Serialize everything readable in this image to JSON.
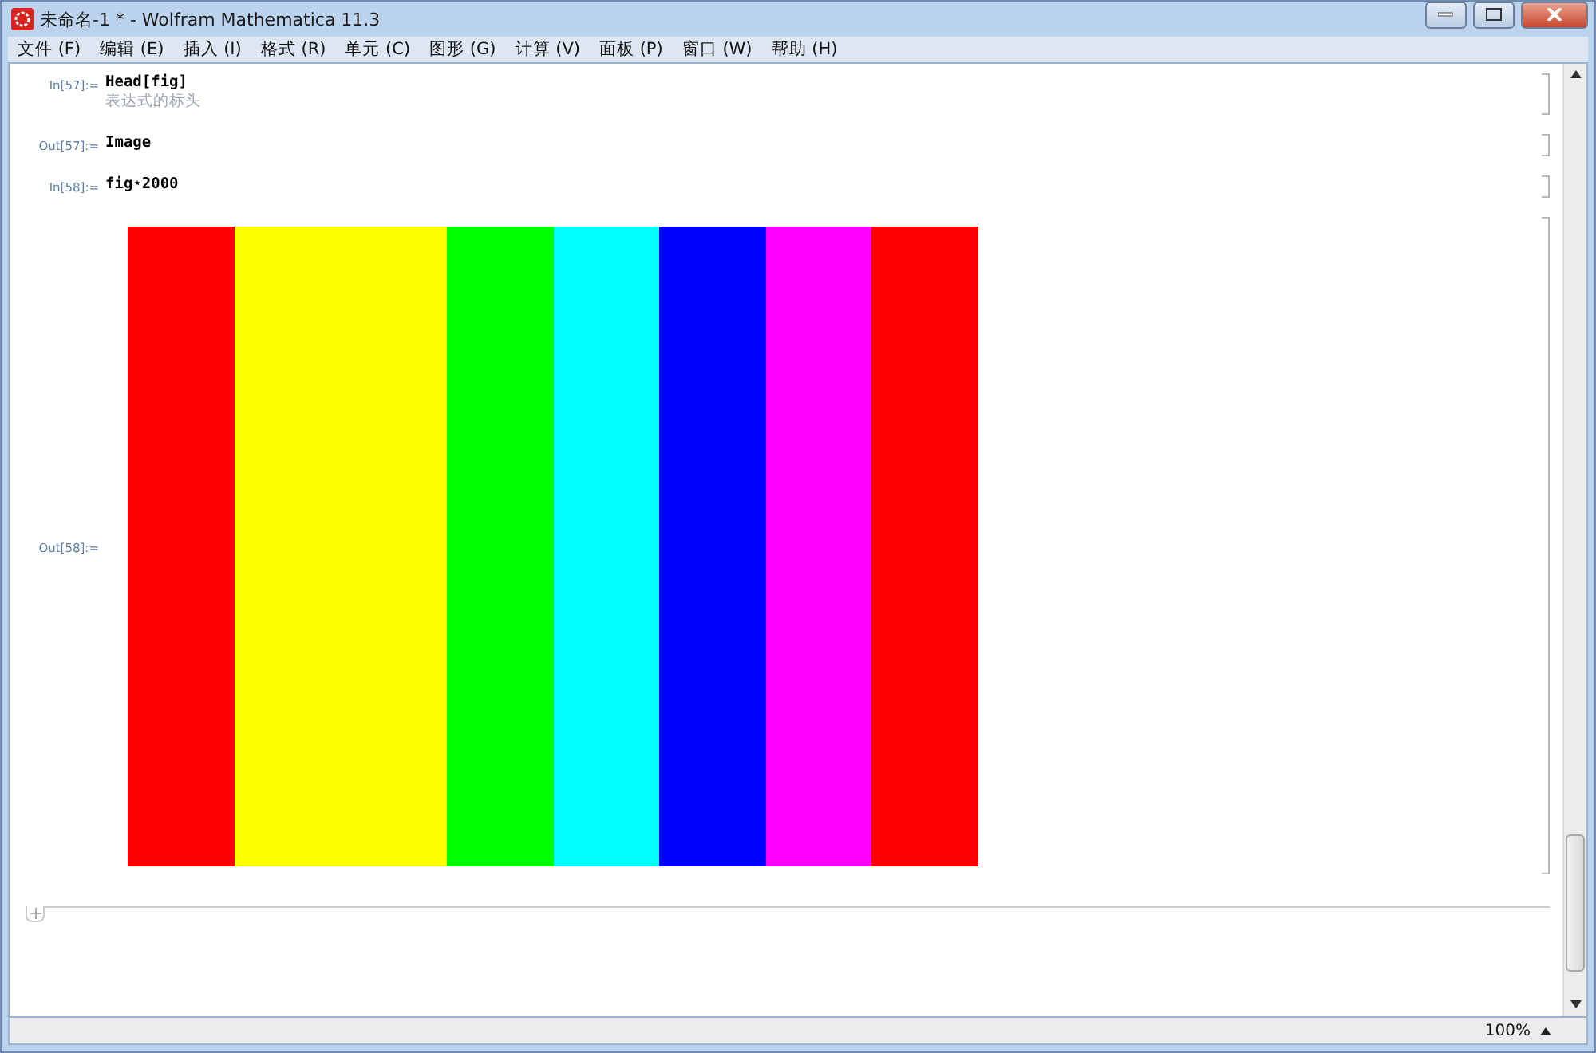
{
  "window": {
    "title": "未命名-1 * - Wolfram Mathematica 11.3"
  },
  "menu": [
    {
      "label": "文件 (F)"
    },
    {
      "label": "编辑 (E)"
    },
    {
      "label": "插入 (I)"
    },
    {
      "label": "格式 (R)"
    },
    {
      "label": "单元 (C)"
    },
    {
      "label": "图形 (G)"
    },
    {
      "label": "计算 (V)"
    },
    {
      "label": "面板 (P)"
    },
    {
      "label": "窗口 (W)"
    },
    {
      "label": "帮助 (H)"
    }
  ],
  "cells": [
    {
      "kind": "input",
      "label": "In[57]:=",
      "code": "Head[fig]",
      "hint": "表达式的标头"
    },
    {
      "kind": "output",
      "label": "Out[57]:=",
      "code": "Image"
    },
    {
      "kind": "input",
      "label": "In[58]:=",
      "code": "fig⋆2000"
    },
    {
      "kind": "image",
      "label": "Out[58]:=",
      "stripes": [
        {
          "color": "#ff0000"
        },
        {
          "color": "#ffff00"
        },
        {
          "color": "#ffff00"
        },
        {
          "color": "#00ff00"
        },
        {
          "color": "#00ffff"
        },
        {
          "color": "#0000ff"
        },
        {
          "color": "#ff00ff"
        },
        {
          "color": "#ff0000"
        }
      ]
    }
  ],
  "status_bar": {
    "zoom": "100%"
  }
}
